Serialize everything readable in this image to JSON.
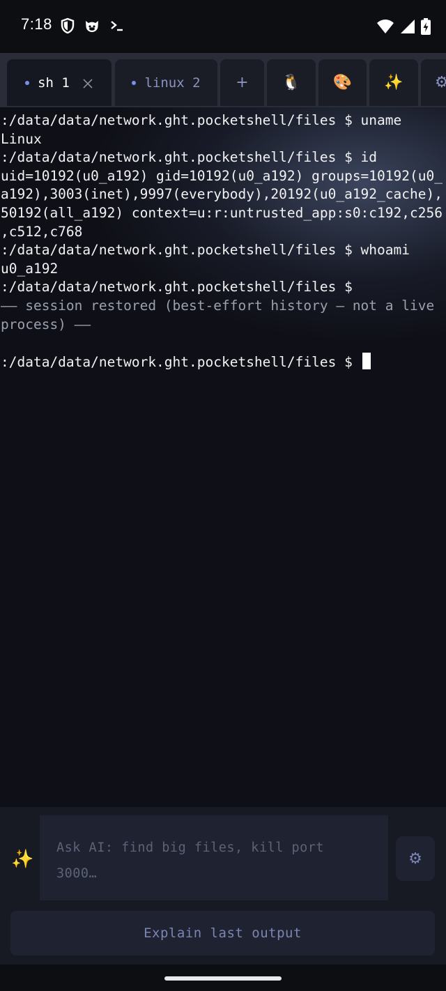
{
  "status_bar": {
    "time": "7:18",
    "left_icons": [
      "shield-icon",
      "cat-face-icon",
      "terminal-prompt-icon"
    ],
    "right_icons": [
      "wifi-icon",
      "cellular-signal-icon",
      "battery-charging-icon"
    ]
  },
  "tabs": [
    {
      "label": "sh 1",
      "active": true,
      "closable": true
    },
    {
      "label": "linux 2",
      "active": false,
      "closable": false
    }
  ],
  "tab_actions": [
    {
      "icon": "plus-icon",
      "glyph": "+"
    },
    {
      "icon": "penguin-icon",
      "glyph": "🐧"
    },
    {
      "icon": "palette-icon",
      "glyph": "🎨"
    },
    {
      "icon": "sparkles-icon",
      "glyph": "✨"
    },
    {
      "icon": "gear-icon",
      "glyph": "⚙"
    }
  ],
  "terminal": {
    "lines": [
      ":/data/data/network.ght.pocketshell/files $ uname",
      "Linux",
      ":/data/data/network.ght.pocketshell/files $ id",
      "uid=10192(u0_a192) gid=10192(u0_a192) groups=10192(u0_",
      "a192),3003(inet),9997(everybody),20192(u0_a192_cache),",
      "50192(all_a192) context=u:r:untrusted_app:s0:c192,c256",
      ",c512,c768",
      ":/data/data/network.ght.pocketshell/files $ whoami",
      "u0_a192",
      ":/data/data/network.ght.pocketshell/files $",
      "—— session restored (best-effort history — not a live",
      "process) ——",
      "",
      ":/data/data/network.ght.pocketshell/files $"
    ],
    "dim_lines": [
      10,
      11
    ]
  },
  "ai_bar": {
    "sparkle_glyph": "✨",
    "placeholder": "Ask AI: find big files, kill port 3000…",
    "settings_glyph": "⚙",
    "explain_label": "Explain last output"
  }
}
